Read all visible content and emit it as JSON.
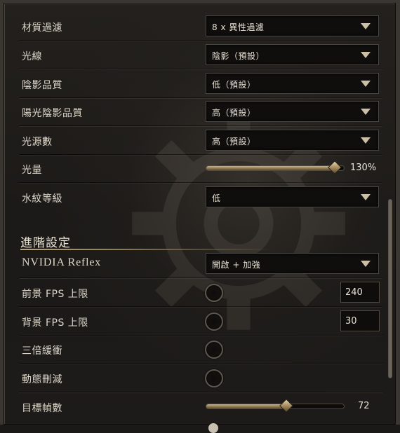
{
  "settings": {
    "texture_filter": {
      "label": "材質過濾",
      "value": "8 x 異性過濾"
    },
    "lighting": {
      "label": "光線",
      "value": "陰影（預設）"
    },
    "shadow_quality": {
      "label": "陰影品質",
      "value": "低（預設）"
    },
    "sun_shadow_quality": {
      "label": "陽光陰影品質",
      "value": "高（預設）"
    },
    "light_sources": {
      "label": "光源數",
      "value": "高（預設）"
    },
    "brightness": {
      "label": "光量",
      "value": "130%",
      "level_percent": 93
    },
    "water_level": {
      "label": "水紋等級",
      "value": "低"
    }
  },
  "advanced": {
    "header": "進階設定",
    "reflex": {
      "label": "NVIDIA Reflex",
      "value": "開啟 + 加強"
    },
    "fg_fps": {
      "label": "前景 FPS 上限",
      "value": "240"
    },
    "bg_fps": {
      "label": "背景 FPS 上限",
      "value": "30"
    },
    "triple_buffer": {
      "label": "三倍緩衝"
    },
    "dynamic_cull": {
      "label": "動態刪減"
    },
    "target_fps": {
      "label": "目標幀數",
      "value": "72",
      "level_fraction": 0.58
    }
  },
  "colors": {
    "accent": "#b9a57c",
    "background": "#1b1917",
    "text": "#ddd6ca"
  }
}
